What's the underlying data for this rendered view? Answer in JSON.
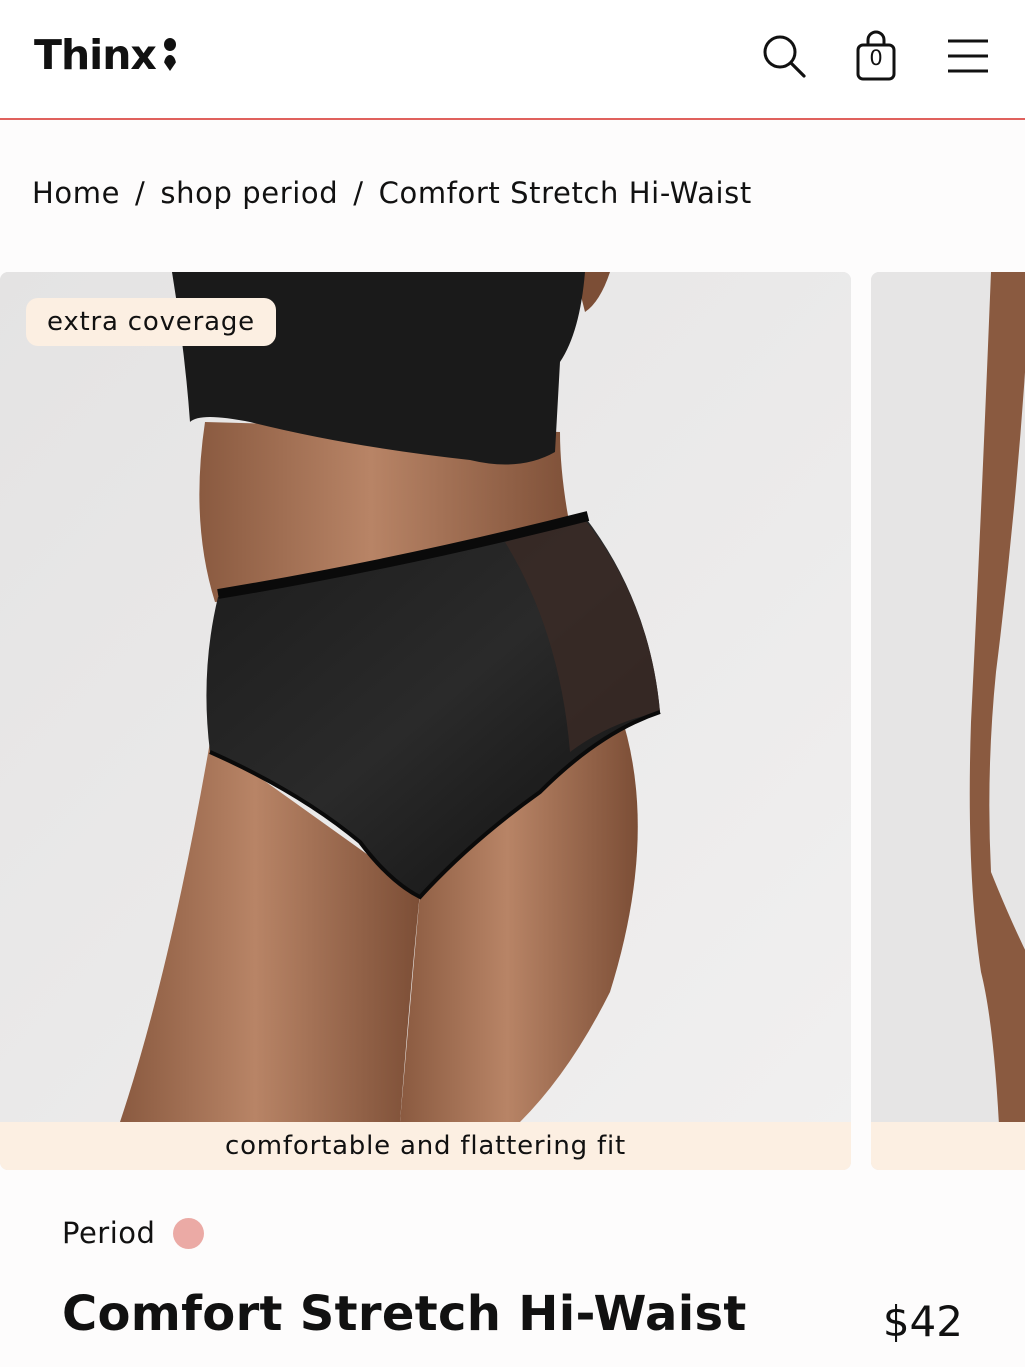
{
  "header": {
    "logo_text": "Thinx",
    "search_icon": "search-icon",
    "cart_icon": "shopping-bag-icon",
    "cart_count": "0",
    "menu_icon": "hamburger-menu-icon",
    "accent_color": "#e0615d"
  },
  "breadcrumb": {
    "items": [
      {
        "label": "Home"
      },
      {
        "label": "shop period"
      },
      {
        "label": "Comfort Stretch Hi-Waist"
      }
    ],
    "separator": "/"
  },
  "gallery": {
    "slides": [
      {
        "badge": "extra coverage",
        "caption": "comfortable and flattering fit"
      },
      {
        "caption": ""
      }
    ],
    "badge_color": "#fcefe2"
  },
  "product": {
    "category": "Period",
    "category_dot_color": "#ebaaa5",
    "title": "Comfort Stretch Hi-Waist",
    "price": "$42"
  }
}
